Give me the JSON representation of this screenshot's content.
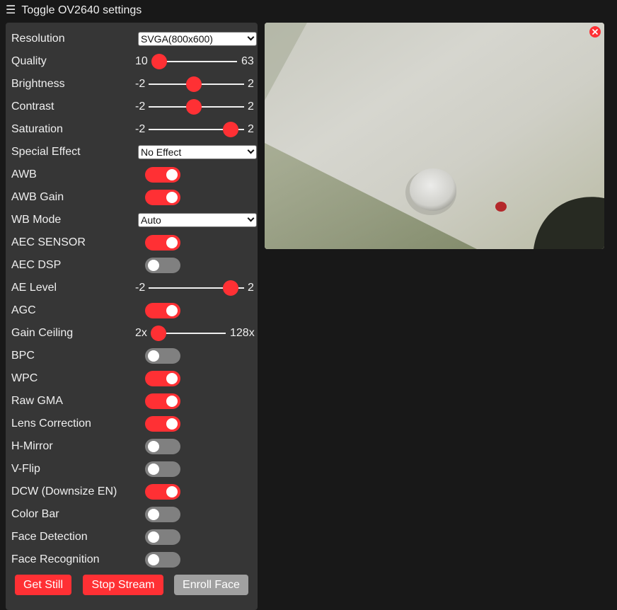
{
  "header": {
    "menu_icon": "menu-icon",
    "title": "Toggle OV2640 settings"
  },
  "settings": {
    "resolution": {
      "label": "Resolution",
      "value": "SVGA(800x600)"
    },
    "quality": {
      "label": "Quality",
      "min": "10",
      "max": "63",
      "value": 10
    },
    "brightness": {
      "label": "Brightness",
      "min": "-2",
      "max": "2",
      "value": 0
    },
    "contrast": {
      "label": "Contrast",
      "min": "-2",
      "max": "2",
      "value": 0
    },
    "saturation": {
      "label": "Saturation",
      "min": "-2",
      "max": "2",
      "value": 2
    },
    "special_effect": {
      "label": "Special Effect",
      "value": "No Effect"
    },
    "awb": {
      "label": "AWB",
      "on": true
    },
    "awb_gain": {
      "label": "AWB Gain",
      "on": true
    },
    "wb_mode": {
      "label": "WB Mode",
      "value": "Auto"
    },
    "aec_sensor": {
      "label": "AEC SENSOR",
      "on": true
    },
    "aec_dsp": {
      "label": "AEC DSP",
      "on": false
    },
    "ae_level": {
      "label": "AE Level",
      "min": "-2",
      "max": "2",
      "value": 2
    },
    "agc": {
      "label": "AGC",
      "on": true
    },
    "gain_ceiling": {
      "label": "Gain Ceiling",
      "min": "2x",
      "max": "128x",
      "value": 0
    },
    "bpc": {
      "label": "BPC",
      "on": false
    },
    "wpc": {
      "label": "WPC",
      "on": true
    },
    "raw_gma": {
      "label": "Raw GMA",
      "on": true
    },
    "lens_correction": {
      "label": "Lens Correction",
      "on": true
    },
    "h_mirror": {
      "label": "H-Mirror",
      "on": false
    },
    "v_flip": {
      "label": "V-Flip",
      "on": false
    },
    "dcw": {
      "label": "DCW (Downsize EN)",
      "on": true
    },
    "color_bar": {
      "label": "Color Bar",
      "on": false
    },
    "face_detection": {
      "label": "Face Detection",
      "on": false
    },
    "face_recognition": {
      "label": "Face Recognition",
      "on": false
    }
  },
  "buttons": {
    "get_still": "Get Still",
    "stop_stream": "Stop Stream",
    "enroll_face": "Enroll Face"
  },
  "stream": {
    "close_icon": "close-icon"
  },
  "colors": {
    "accent": "#ff3034",
    "panel": "#363636",
    "background": "#181818",
    "switch_off": "#808080",
    "disabled": "#a0a0a0"
  }
}
